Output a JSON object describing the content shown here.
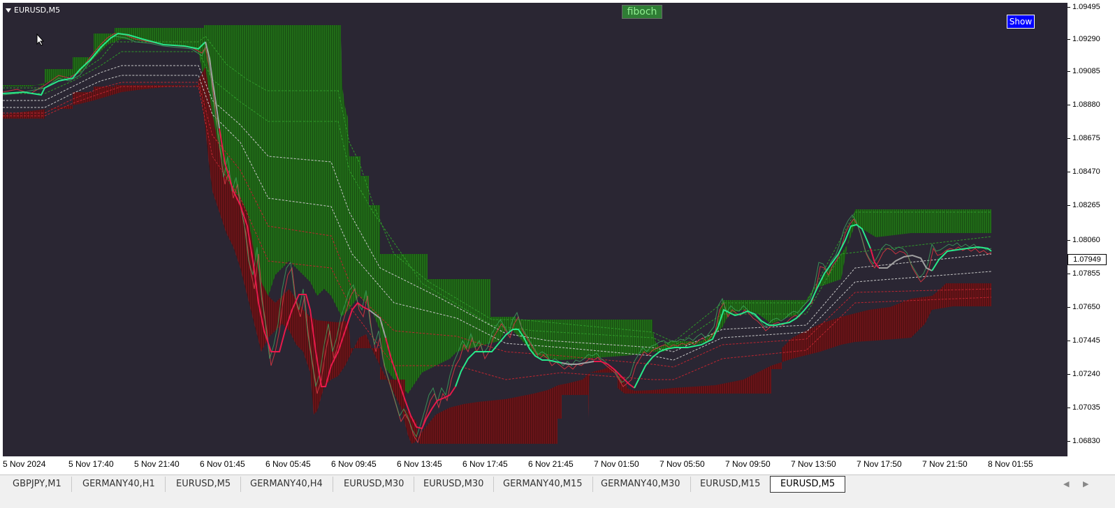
{
  "chart": {
    "symbol_label": "EURUSD,M5",
    "indicator_label": "fiboch",
    "show_button": "Show",
    "current_price": "1.07949",
    "price_ticks": [
      "1.09495",
      "1.09290",
      "1.09085",
      "1.08880",
      "1.08675",
      "1.08470",
      "1.08265",
      "1.08060",
      "1.07855",
      "1.07650",
      "1.07445",
      "1.07240",
      "1.07035",
      "1.06830"
    ],
    "time_ticks": [
      "5 Nov 2024",
      "5 Nov 17:40",
      "5 Nov 21:40",
      "6 Nov 01:45",
      "6 Nov 05:45",
      "6 Nov 09:45",
      "6 Nov 13:45",
      "6 Nov 17:45",
      "6 Nov 21:45",
      "7 Nov 01:50",
      "7 Nov 05:50",
      "7 Nov 09:50",
      "7 Nov 13:50",
      "7 Nov 17:50",
      "7 Nov 21:50",
      "8 Nov 01:55"
    ],
    "colors": {
      "background": "#2a2633",
      "upper_band": "#1f6b14",
      "lower_band": "#6e1414",
      "up_line": "#28e88a",
      "down_line": "#e8194b",
      "neutral_line": "#a0a0a0"
    }
  },
  "tabs": [
    {
      "label": "GBPJPY,M1",
      "active": false
    },
    {
      "label": "GERMANY40,H1",
      "active": false
    },
    {
      "label": "EURUSD,M5",
      "active": false
    },
    {
      "label": "GERMANY40,H4",
      "active": false
    },
    {
      "label": "EURUSD,M30",
      "active": false
    },
    {
      "label": "EURUSD,M30",
      "active": false
    },
    {
      "label": "GERMANY40,M15",
      "active": false
    },
    {
      "label": "GERMANY40,M30",
      "active": false
    },
    {
      "label": "EURUSD,M15",
      "active": false
    },
    {
      "label": "EURUSD,M5",
      "active": true
    }
  ]
}
